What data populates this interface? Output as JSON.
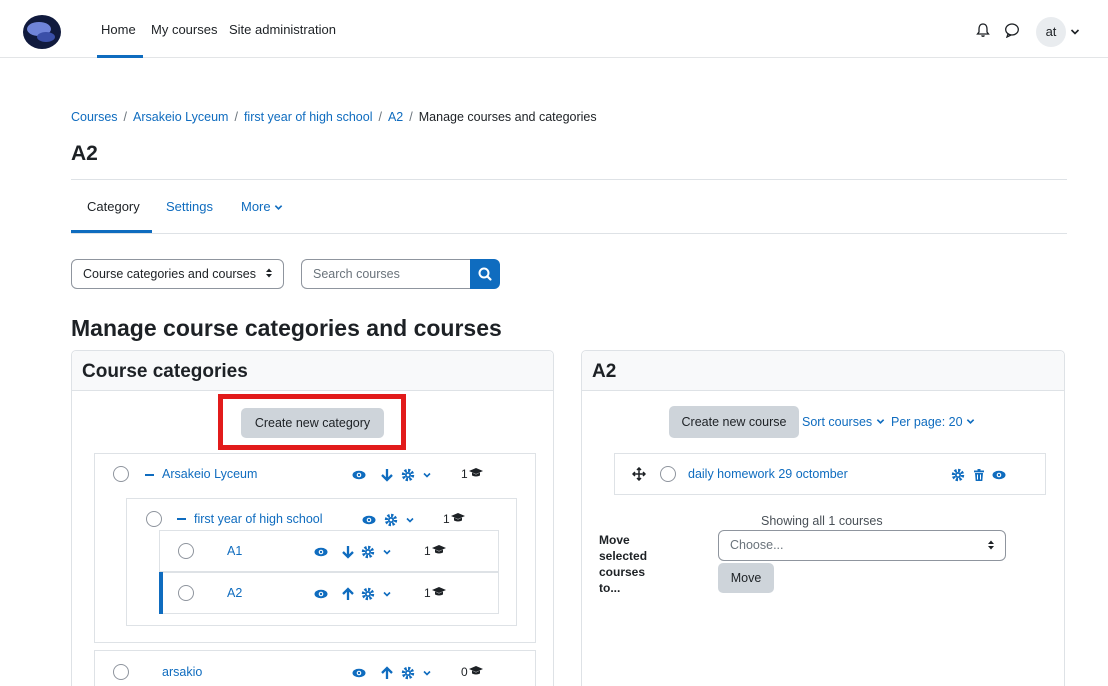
{
  "navbar": {
    "home": "Home",
    "my_courses": "My courses",
    "site_admin": "Site administration",
    "user_initials": "at"
  },
  "breadcrumb": [
    "Courses",
    "Arsakeio Lyceum",
    "first year of high school",
    "A2",
    "Manage courses and categories"
  ],
  "page_title": "A2",
  "tabs": {
    "category": "Category",
    "settings": "Settings",
    "more": "More"
  },
  "controls": {
    "view_select": "Course categories and courses",
    "search_placeholder": "Search courses"
  },
  "section_title": "Manage course categories and courses",
  "categories_panel": {
    "title": "Course categories",
    "create_button": "Create new category",
    "items": [
      {
        "name": "Arsakeio Lyceum",
        "count": "1"
      },
      {
        "name": "first year of high school",
        "count": "1"
      },
      {
        "name": "A1",
        "count": "1"
      },
      {
        "name": "A2",
        "count": "1"
      },
      {
        "name": "arsakio",
        "count": "0"
      }
    ]
  },
  "courses_panel": {
    "title": "A2",
    "create_button": "Create new course",
    "sort_link": "Sort courses",
    "per_page": "Per page: 20",
    "courses": [
      {
        "name": "daily homework 29 octomber"
      }
    ],
    "showing": "Showing all 1 courses",
    "move_label": "Move selected courses to...",
    "choose_placeholder": "Choose...",
    "move_button": "Move"
  },
  "colors": {
    "accent": "#0f6cbf",
    "highlight": "#e21b1b",
    "button_grey": "#ced4da"
  }
}
